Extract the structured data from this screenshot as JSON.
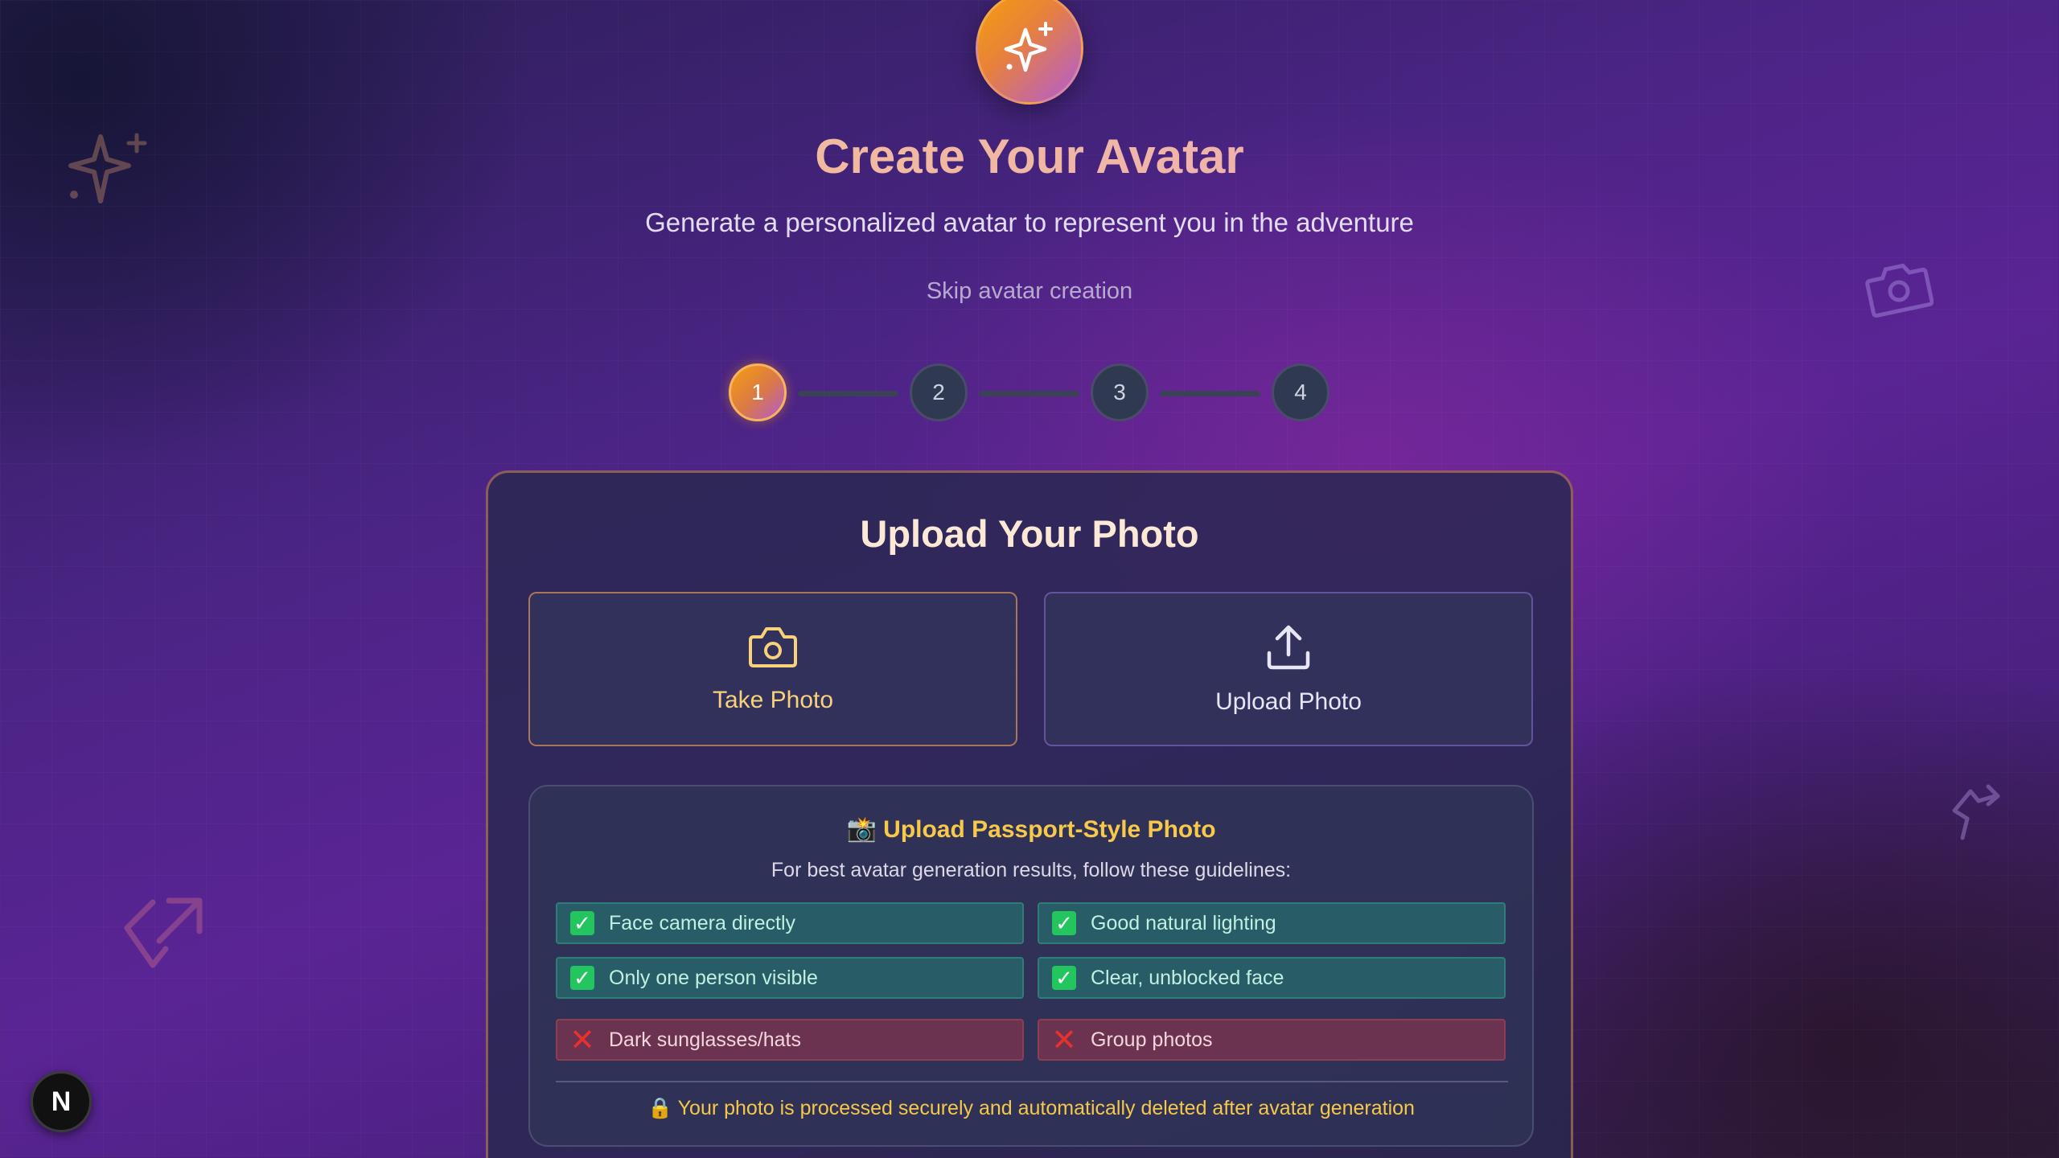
{
  "header": {
    "title": "Create Your Avatar",
    "subtitle": "Generate a personalized avatar to represent you in the adventure",
    "skip_label": "Skip avatar creation"
  },
  "stepper": {
    "steps": [
      "1",
      "2",
      "3",
      "4"
    ],
    "active_step": "1"
  },
  "upload_card": {
    "title": "Upload Your Photo",
    "take_photo_label": "Take Photo",
    "upload_photo_label": "Upload Photo"
  },
  "guidelines": {
    "title_emoji": "📸",
    "title": "Upload Passport-Style Photo",
    "subtitle": "For best avatar generation results, follow these guidelines:",
    "do_items": [
      "Face camera directly",
      "Good natural lighting",
      "Only one person visible",
      "Clear, unblocked face"
    ],
    "dont_items": [
      "Dark sunglasses/hats",
      "Group photos"
    ],
    "footnote_emoji": "🔒",
    "footnote": "Your photo is processed securely and automatically deleted after avatar generation"
  },
  "badge": {
    "letter": "N"
  },
  "icons": {
    "logo": "sparkles-icon",
    "take_photo": "camera-icon",
    "upload_photo": "upload-icon",
    "check": "check-icon",
    "cross": "cross-icon"
  },
  "colors": {
    "accent_orange": "#f59e0b",
    "accent_purple": "#b05ad8",
    "ok_green": "#22c55e",
    "bad_red": "#e5322e",
    "guideline_yellow": "#f7c84a"
  }
}
